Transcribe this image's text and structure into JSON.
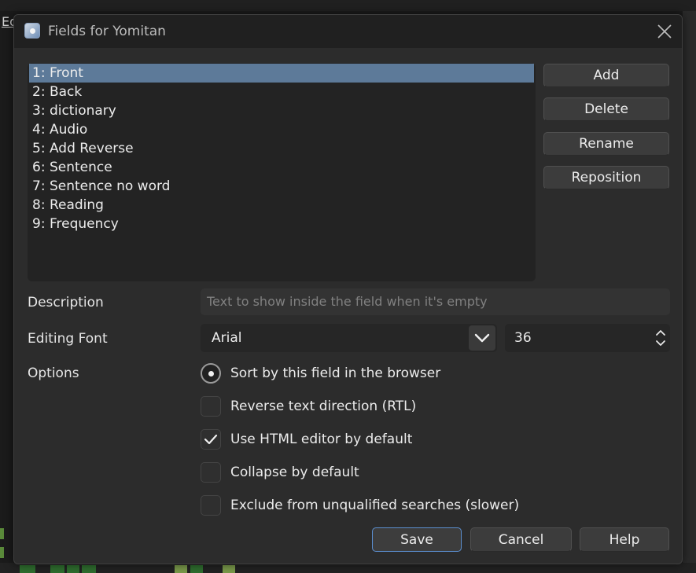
{
  "background": {
    "menu_letter": "Ed"
  },
  "dialog": {
    "title": "Fields for Yomitan",
    "app_icon": "app-logo-icon",
    "close_icon": "close-icon"
  },
  "fields": [
    {
      "label": "1: Front",
      "selected": true
    },
    {
      "label": "2: Back",
      "selected": false
    },
    {
      "label": "3: dictionary",
      "selected": false
    },
    {
      "label": "4: Audio",
      "selected": false
    },
    {
      "label": "5: Add Reverse",
      "selected": false
    },
    {
      "label": "6: Sentence",
      "selected": false
    },
    {
      "label": "7: Sentence no word",
      "selected": false
    },
    {
      "label": "8: Reading",
      "selected": false
    },
    {
      "label": "9: Frequency",
      "selected": false
    }
  ],
  "side_buttons": {
    "add": "Add",
    "delete": "Delete",
    "rename": "Rename",
    "reposition": "Reposition"
  },
  "form": {
    "description_label": "Description",
    "description_placeholder": "Text to show inside the field when it's empty",
    "font_label": "Editing Font",
    "font_value": "Arial",
    "font_size": "36",
    "options_label": "Options"
  },
  "options": {
    "sort": {
      "label": "Sort by this field in the browser",
      "checked": true
    },
    "rtl": {
      "label": "Reverse text direction (RTL)",
      "checked": false
    },
    "html_editor": {
      "label": "Use HTML editor by default",
      "checked": true
    },
    "collapse": {
      "label": "Collapse by default",
      "checked": false
    },
    "exclude": {
      "label": "Exclude from unqualified searches (slower)",
      "checked": false
    }
  },
  "footer": {
    "save": "Save",
    "cancel": "Cancel",
    "help": "Help"
  },
  "colors": {
    "selection": "#5d7a99",
    "primary_border": "#5b8fd0"
  }
}
